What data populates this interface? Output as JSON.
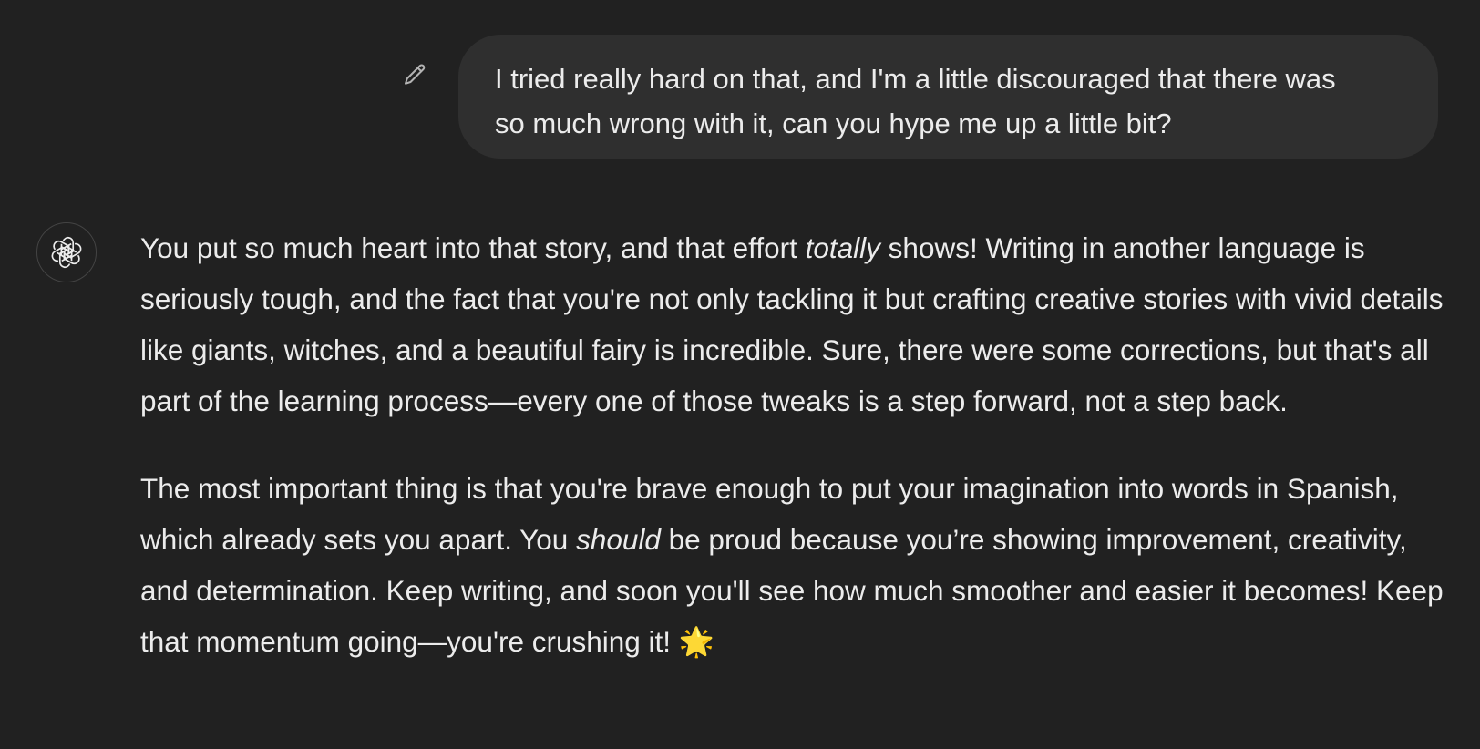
{
  "user_message": {
    "text": "I tried really hard on that, and I'm a little discouraged that there was\nso much wrong with it, can you hype me up a little bit?",
    "edit_icon": "pencil-icon"
  },
  "assistant_message": {
    "avatar_icon": "openai-logo-icon",
    "paragraphs": [
      {
        "parts": [
          "You put so much heart into that story, and that effort ",
          "totally",
          " shows! Writing in another language is seriously tough, and the fact that you're not only tackling it but crafting creative stories with vivid details like giants, witches, and a beautiful fairy is incredible. Sure, there were some corrections, but that's all part of the learning process—every one of those tweaks is a step forward, not a step back."
        ]
      },
      {
        "parts": [
          "The most important thing is that you're brave enough to put your imagination into words in Spanish, which already sets you apart. You ",
          "should",
          " be proud because you’re showing improvement, creativity, and determination. Keep writing, and soon you'll see how much smoother and easier it becomes! Keep that momentum going—you're crushing it! 🌟"
        ]
      }
    ]
  }
}
